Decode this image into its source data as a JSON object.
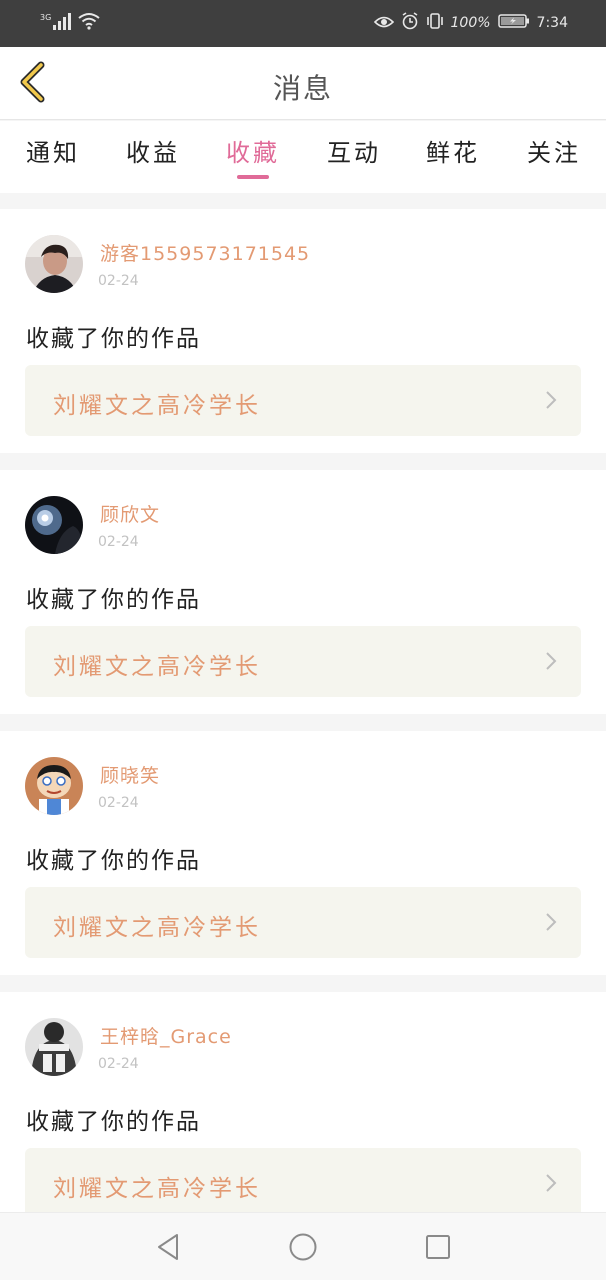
{
  "status_bar": {
    "network": "3G",
    "battery_percent": "100%",
    "time": "7:34",
    "icons": [
      "signal-icon",
      "wifi-icon",
      "eye-icon",
      "alarm-icon",
      "vibrate-icon",
      "battery-icon"
    ]
  },
  "header": {
    "title": "消息",
    "back_icon": "chevron-left-icon"
  },
  "tabs": [
    {
      "label": "通知",
      "active": false
    },
    {
      "label": "收益",
      "active": false
    },
    {
      "label": "收藏",
      "active": true
    },
    {
      "label": "互动",
      "active": false
    },
    {
      "label": "鲜花",
      "active": false
    },
    {
      "label": "关注",
      "active": false
    }
  ],
  "notifications": [
    {
      "username": "游客15595731​7​1545",
      "date": "02-24",
      "action": "收藏了你的作品",
      "work_title": "刘耀文之高冷学长"
    },
    {
      "username": "顾欣文",
      "date": "02-24",
      "action": "收藏了你的作品",
      "work_title": "刘耀文之高冷学长"
    },
    {
      "username": "顾晓笑",
      "date": "02-24",
      "action": "收藏了你的作品",
      "work_title": "刘耀文之高冷学长"
    },
    {
      "username": "王梓晗_Grace",
      "date": "02-24",
      "action": "收藏了你的作品",
      "work_title": "刘耀文之高冷学长"
    }
  ],
  "nav": {
    "icons": [
      "back-triangle-icon",
      "home-circle-icon",
      "recents-square-icon"
    ]
  },
  "colors": {
    "accent_pink": "#e06b98",
    "username_orange": "#e39a73",
    "back_arrow_yellow": "#f2c94c",
    "status_bar_bg": "#3f3f3f"
  }
}
